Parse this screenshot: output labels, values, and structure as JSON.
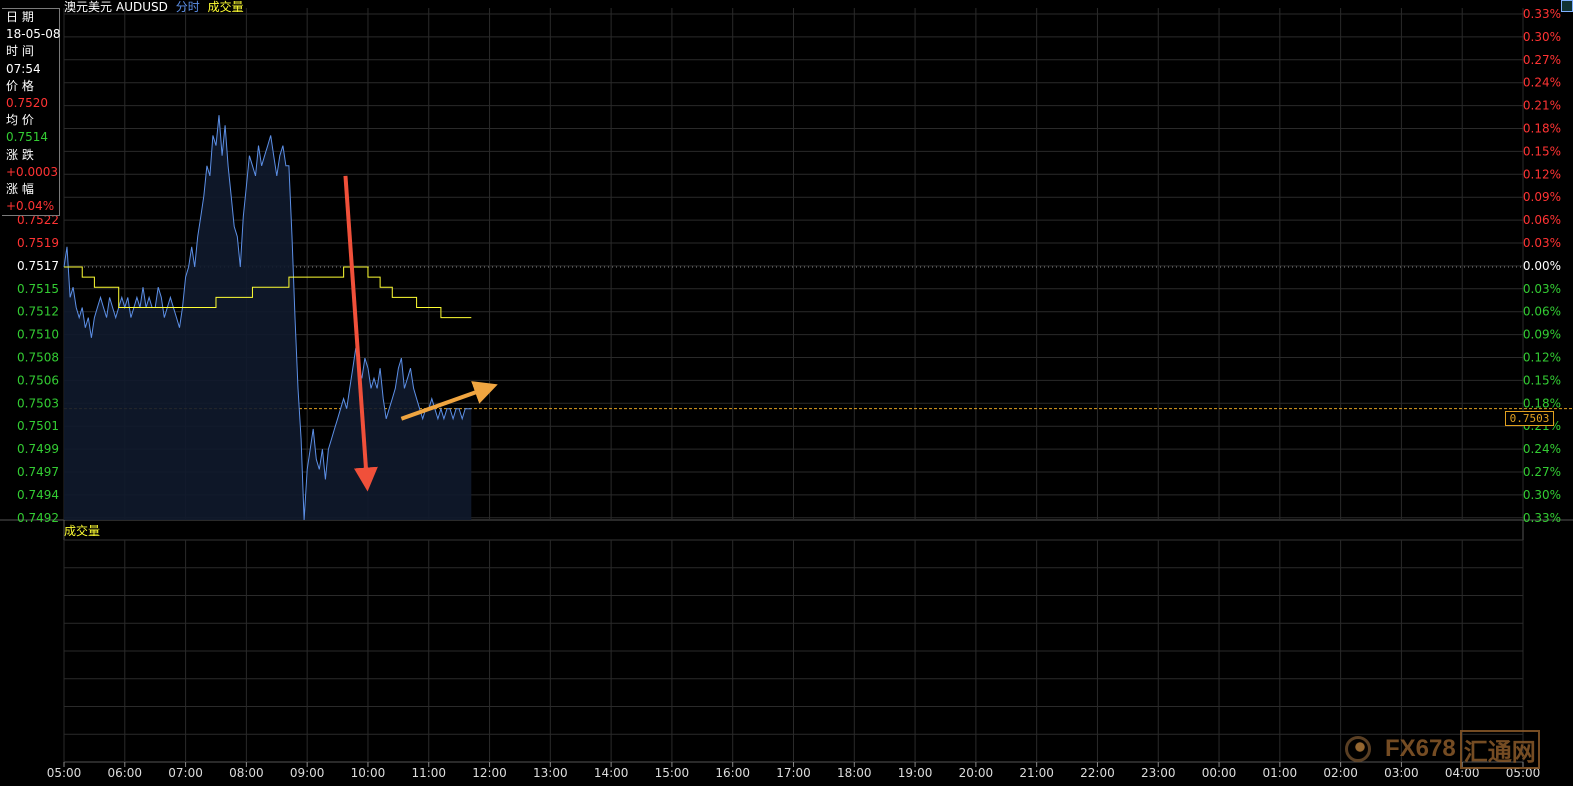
{
  "header": {
    "symbol_name": "澳元美元",
    "symbol_code": "AUDUSD",
    "mode_label": "分时",
    "volume_label": "成交量"
  },
  "info_panel": {
    "date_label": "日 期",
    "date_value": "18-05-08",
    "time_label": "时 间",
    "time_value": "07:54",
    "price_label": "价 格",
    "price_value": "0.7520",
    "avg_label": "均 价",
    "avg_value": "0.7514",
    "change_label": "涨 跌",
    "change_value": "+0.0003",
    "pct_label": "涨 幅",
    "pct_value": "+0.04%"
  },
  "price_tag": "0.7503",
  "volume_panel": {
    "label": "成交量"
  },
  "watermark": {
    "brand": "FX678",
    "cn": "汇通网"
  },
  "colors": {
    "up": "#ff3333",
    "down": "#33cc33",
    "neutral": "#ffffff",
    "price_line": "#5c8fe6",
    "avg_line": "#ffff33",
    "grid": "#2a2a2a",
    "ref_line": "#e0a020",
    "arrow_down": "#f0503a",
    "arrow_up": "#f0a540"
  },
  "chart_data": {
    "type": "line",
    "xlabel": "",
    "ylabel": "",
    "x_ticks": [
      "05:00",
      "06:00",
      "07:00",
      "08:00",
      "09:00",
      "10:00",
      "11:00",
      "12:00",
      "13:00",
      "14:00",
      "15:00",
      "16:00",
      "17:00",
      "18:00",
      "19:00",
      "20:00",
      "21:00",
      "22:00",
      "23:00",
      "00:00",
      "01:00",
      "02:00",
      "03:00",
      "04:00",
      "05:00"
    ],
    "y_ticks_left": [
      "0.7522",
      "0.7519",
      "0.7517",
      "0.7515",
      "0.7512",
      "0.7510",
      "0.7508",
      "0.7506",
      "0.7503",
      "0.7501",
      "0.7499",
      "0.7497",
      "0.7494",
      "0.7492"
    ],
    "y_ticks_right": [
      "0.33%",
      "0.30%",
      "0.27%",
      "0.24%",
      "0.21%",
      "0.18%",
      "0.15%",
      "0.12%",
      "0.09%",
      "0.06%",
      "0.03%",
      "0.00%",
      "0.03%",
      "0.06%",
      "0.09%",
      "0.12%",
      "0.15%",
      "0.18%",
      "0.21%",
      "0.24%",
      "0.27%",
      "0.30%",
      "0.33%"
    ],
    "reference_price": 0.7517,
    "last_price": 0.7503,
    "ylim": [
      0.7492,
      0.7542
    ],
    "series": [
      {
        "name": "",
        "x_hours": [
          0,
          0.05,
          0.1,
          0.15,
          0.2,
          0.25,
          0.3,
          0.35,
          0.4,
          0.45,
          0.5,
          0.55,
          0.6,
          0.65,
          0.7,
          0.75,
          0.8,
          0.85,
          0.9,
          0.95,
          1.0,
          1.05,
          1.1,
          1.15,
          1.2,
          1.25,
          1.3,
          1.35,
          1.4,
          1.45,
          1.5,
          1.55,
          1.6,
          1.65,
          1.7,
          1.75,
          1.8,
          1.85,
          1.9,
          1.95,
          2.0,
          2.05,
          2.1,
          2.15,
          2.2,
          2.25,
          2.3,
          2.35,
          2.4,
          2.45,
          2.5,
          2.55,
          2.6,
          2.65,
          2.7,
          2.75,
          2.8,
          2.85,
          2.9,
          2.95,
          3.0,
          3.05,
          3.1,
          3.15,
          3.2,
          3.25,
          3.3,
          3.35,
          3.4,
          3.45,
          3.5,
          3.55,
          3.6,
          3.65,
          3.7,
          3.75,
          3.8,
          3.85,
          3.9,
          3.95,
          4.0,
          4.05,
          4.1,
          4.15,
          4.2,
          4.25,
          4.3,
          4.35,
          4.4,
          4.45,
          4.5,
          4.55,
          4.6,
          4.65,
          4.7,
          4.75,
          4.8,
          4.85,
          4.9,
          4.95,
          5.0,
          5.05,
          5.1,
          5.15,
          5.2,
          5.25,
          5.3,
          5.35,
          5.4,
          5.45,
          5.5,
          5.55,
          5.6,
          5.65,
          5.7,
          5.75,
          5.8,
          5.85,
          5.9,
          5.95,
          6.0,
          6.05,
          6.1,
          6.15,
          6.2,
          6.25,
          6.3,
          6.35,
          6.4,
          6.45,
          6.5,
          6.55,
          6.6,
          6.65,
          6.7
        ],
        "values": [
          0.7517,
          0.7519,
          0.7514,
          0.7515,
          0.7513,
          0.7512,
          0.7513,
          0.7511,
          0.7512,
          0.751,
          0.7512,
          0.7513,
          0.7514,
          0.7513,
          0.7512,
          0.7514,
          0.7513,
          0.7512,
          0.7513,
          0.7514,
          0.7513,
          0.7514,
          0.7512,
          0.7513,
          0.7514,
          0.7513,
          0.7515,
          0.7513,
          0.7514,
          0.7513,
          0.7513,
          0.7515,
          0.7514,
          0.7512,
          0.7513,
          0.7514,
          0.7513,
          0.7512,
          0.7511,
          0.7513,
          0.7516,
          0.7517,
          0.7519,
          0.7517,
          0.752,
          0.7522,
          0.7524,
          0.7527,
          0.7526,
          0.753,
          0.7529,
          0.7532,
          0.7528,
          0.7531,
          0.7527,
          0.7524,
          0.7521,
          0.752,
          0.7517,
          0.7522,
          0.7525,
          0.7528,
          0.7527,
          0.7526,
          0.7529,
          0.7527,
          0.7528,
          0.7529,
          0.753,
          0.7528,
          0.7526,
          0.7528,
          0.7529,
          0.7527,
          0.7527,
          0.752,
          0.7512,
          0.7505,
          0.75,
          0.7492,
          0.7497,
          0.7499,
          0.7501,
          0.7498,
          0.7497,
          0.7499,
          0.7496,
          0.7499,
          0.75,
          0.7501,
          0.7502,
          0.7503,
          0.7504,
          0.7503,
          0.7505,
          0.7507,
          0.7509,
          0.7507,
          0.7506,
          0.7508,
          0.7507,
          0.7505,
          0.7506,
          0.7505,
          0.7507,
          0.7504,
          0.7502,
          0.7503,
          0.7504,
          0.7505,
          0.7507,
          0.7508,
          0.7505,
          0.7506,
          0.7507,
          0.7505,
          0.7504,
          0.7503,
          0.7502,
          0.7503,
          0.7503,
          0.7504,
          0.7503,
          0.7502,
          0.7503,
          0.7502,
          0.7503,
          0.7503,
          0.7502,
          0.7503,
          0.7503,
          0.7502,
          0.7503,
          0.7503,
          0.7503
        ]
      },
      {
        "name": "",
        "x_hours": [
          0,
          0.3,
          0.5,
          0.9,
          1.2,
          1.5,
          1.9,
          2.2,
          2.5,
          2.8,
          3.1,
          3.4,
          3.7,
          4.0,
          4.3,
          4.6,
          4.9,
          5.0,
          5.2,
          5.4,
          5.6,
          5.8,
          6.0,
          6.2,
          6.4,
          6.7
        ],
        "values": [
          0.7517,
          0.7516,
          0.7515,
          0.7513,
          0.7513,
          0.7513,
          0.7513,
          0.7513,
          0.7514,
          0.7514,
          0.7515,
          0.7515,
          0.7516,
          0.7516,
          0.7516,
          0.7517,
          0.7517,
          0.7516,
          0.7515,
          0.7514,
          0.7514,
          0.7513,
          0.7513,
          0.7512,
          0.7512,
          0.7512
        ]
      }
    ]
  }
}
